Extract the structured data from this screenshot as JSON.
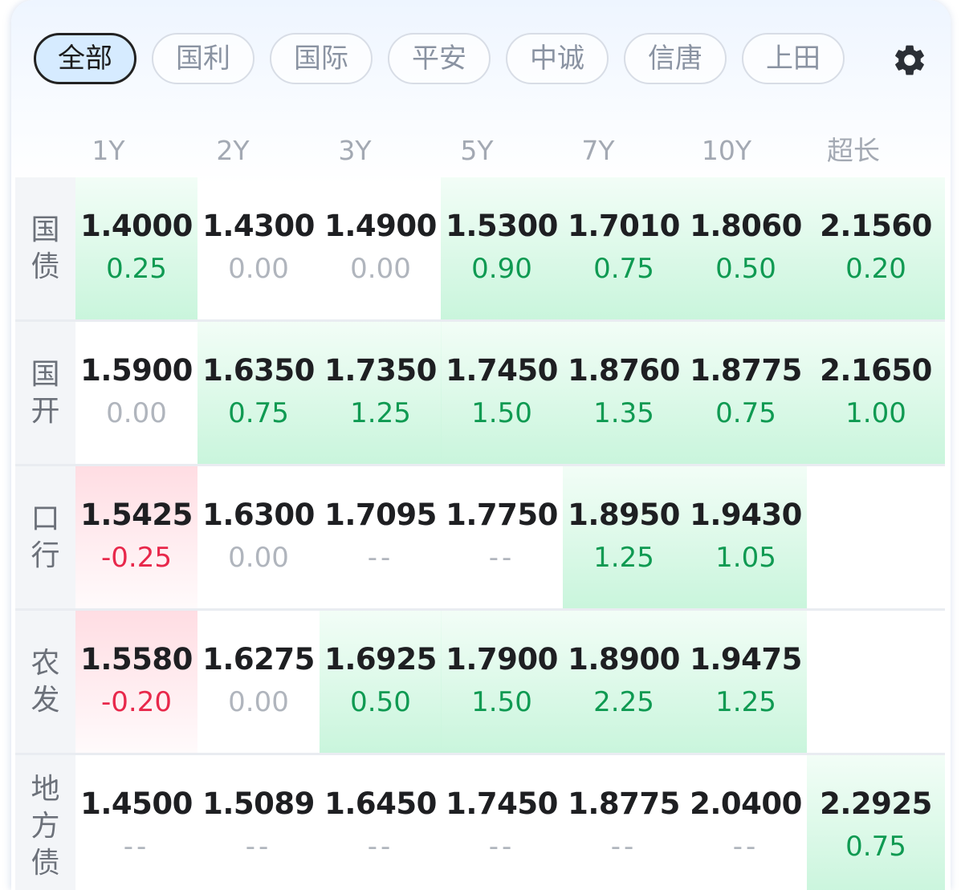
{
  "tabs": [
    {
      "label": "全部",
      "active": true
    },
    {
      "label": "国利",
      "active": false
    },
    {
      "label": "国际",
      "active": false
    },
    {
      "label": "平安",
      "active": false
    },
    {
      "label": "中诚",
      "active": false
    },
    {
      "label": "信唐",
      "active": false
    },
    {
      "label": "上田",
      "active": false
    }
  ],
  "settings_icon": "gear-icon",
  "columns": [
    "1Y",
    "2Y",
    "3Y",
    "5Y",
    "7Y",
    "10Y",
    "超长"
  ],
  "colors": {
    "up": "#0f9a52",
    "down": "#e8284b",
    "flat": "#b0b5bd"
  },
  "rows": [
    {
      "label": "国债",
      "cells": [
        {
          "rate": "1.4000",
          "change": "0.25",
          "trend": "up"
        },
        {
          "rate": "1.4300",
          "change": "0.00",
          "trend": "flat"
        },
        {
          "rate": "1.4900",
          "change": "0.00",
          "trend": "flat"
        },
        {
          "rate": "1.5300",
          "change": "0.90",
          "trend": "up"
        },
        {
          "rate": "1.7010",
          "change": "0.75",
          "trend": "up"
        },
        {
          "rate": "1.8060",
          "change": "0.50",
          "trend": "up"
        },
        {
          "rate": "2.1560",
          "change": "0.20",
          "trend": "up"
        }
      ]
    },
    {
      "label": "国开",
      "cells": [
        {
          "rate": "1.5900",
          "change": "0.00",
          "trend": "flat"
        },
        {
          "rate": "1.6350",
          "change": "0.75",
          "trend": "up"
        },
        {
          "rate": "1.7350",
          "change": "1.25",
          "trend": "up"
        },
        {
          "rate": "1.7450",
          "change": "1.50",
          "trend": "up"
        },
        {
          "rate": "1.8760",
          "change": "1.35",
          "trend": "up"
        },
        {
          "rate": "1.8775",
          "change": "0.75",
          "trend": "up"
        },
        {
          "rate": "2.1650",
          "change": "1.00",
          "trend": "up"
        }
      ]
    },
    {
      "label": "口行",
      "cells": [
        {
          "rate": "1.5425",
          "change": "-0.25",
          "trend": "down"
        },
        {
          "rate": "1.6300",
          "change": "0.00",
          "trend": "flat"
        },
        {
          "rate": "1.7095",
          "change": "--",
          "trend": "none"
        },
        {
          "rate": "1.7750",
          "change": "--",
          "trend": "none"
        },
        {
          "rate": "1.8950",
          "change": "1.25",
          "trend": "up"
        },
        {
          "rate": "1.9430",
          "change": "1.05",
          "trend": "up"
        },
        null
      ]
    },
    {
      "label": "农发",
      "cells": [
        {
          "rate": "1.5580",
          "change": "-0.20",
          "trend": "down"
        },
        {
          "rate": "1.6275",
          "change": "0.00",
          "trend": "flat"
        },
        {
          "rate": "1.6925",
          "change": "0.50",
          "trend": "up"
        },
        {
          "rate": "1.7900",
          "change": "1.50",
          "trend": "up"
        },
        {
          "rate": "1.8900",
          "change": "2.25",
          "trend": "up"
        },
        {
          "rate": "1.9475",
          "change": "1.25",
          "trend": "up"
        },
        null
      ]
    },
    {
      "label": "地方债",
      "cells": [
        {
          "rate": "1.4500",
          "change": "--",
          "trend": "none"
        },
        {
          "rate": "1.5089",
          "change": "--",
          "trend": "none"
        },
        {
          "rate": "1.6450",
          "change": "--",
          "trend": "none"
        },
        {
          "rate": "1.7450",
          "change": "--",
          "trend": "none"
        },
        {
          "rate": "1.8775",
          "change": "--",
          "trend": "none"
        },
        {
          "rate": "2.0400",
          "change": "--",
          "trend": "none"
        },
        {
          "rate": "2.2925",
          "change": "0.75",
          "trend": "up"
        }
      ]
    }
  ]
}
